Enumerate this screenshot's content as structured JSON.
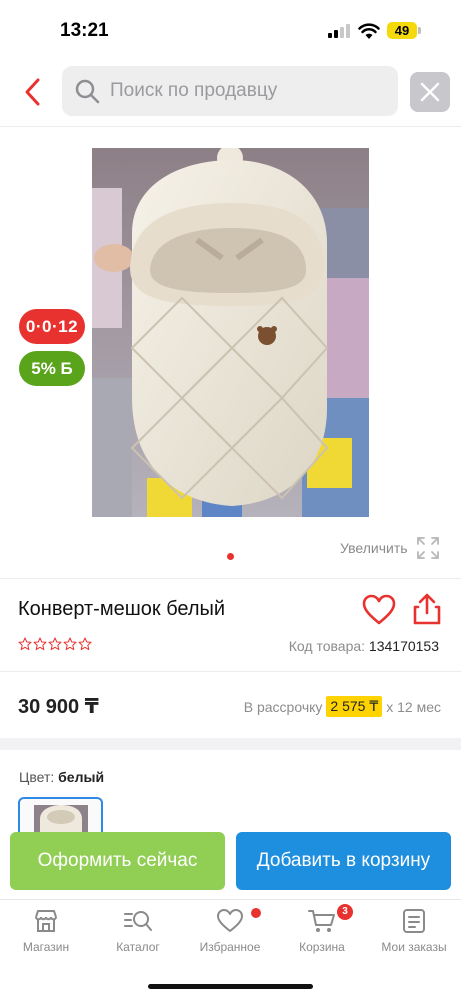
{
  "status_bar": {
    "time": "13:21",
    "battery": "49"
  },
  "header": {
    "search_placeholder": "Поиск по продавцу"
  },
  "badges": {
    "timer": "0·0·12",
    "bonus": "5% Б"
  },
  "gallery": {
    "zoom_label": "Увеличить"
  },
  "product": {
    "title": "Конверт-мешок белый",
    "rating_stars": 0,
    "sku_label": "Код товара:",
    "sku_value": "134170153",
    "price": "30 900 ₸",
    "installment_prefix": "В рассрочку",
    "installment_amount": "2 575 ₸",
    "installment_suffix": "х 12 мес",
    "color_label": "Цвет:",
    "color_value": "белый"
  },
  "actions": {
    "checkout_label": "Оформить сейчас",
    "cart_label": "Добавить в корзину"
  },
  "tabbar": {
    "items": [
      {
        "label": "Магазин",
        "icon": "shop-icon"
      },
      {
        "label": "Каталог",
        "icon": "catalog-search-icon"
      },
      {
        "label": "Избранное",
        "icon": "heart-icon"
      },
      {
        "label": "Корзина",
        "icon": "cart-icon",
        "badge": "3"
      },
      {
        "label": "Мои заказы",
        "icon": "orders-icon"
      }
    ]
  },
  "colors": {
    "accent_red": "#e8322f",
    "bonus_green": "#5aa41c",
    "checkout_green": "#90ce54",
    "cart_blue": "#1e8ede",
    "installment_yellow": "#ffd300"
  }
}
